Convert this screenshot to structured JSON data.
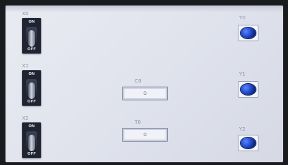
{
  "inputs": [
    {
      "label": "X0",
      "on_text": "ON",
      "off_text": "OFF"
    },
    {
      "label": "X1",
      "on_text": "ON",
      "off_text": "OFF"
    },
    {
      "label": "X2",
      "on_text": "ON",
      "off_text": "OFF"
    }
  ],
  "outputs": [
    {
      "label": "Y0"
    },
    {
      "label": "Y1"
    },
    {
      "label": "Y2"
    }
  ],
  "counter": {
    "label": "C0",
    "value": "0"
  },
  "timer": {
    "label": "T0",
    "value": "0"
  },
  "colors": {
    "lamp_blue": "#2752d8",
    "switch_body": "#1f2430",
    "panel_bg": "#e4e7ef"
  }
}
